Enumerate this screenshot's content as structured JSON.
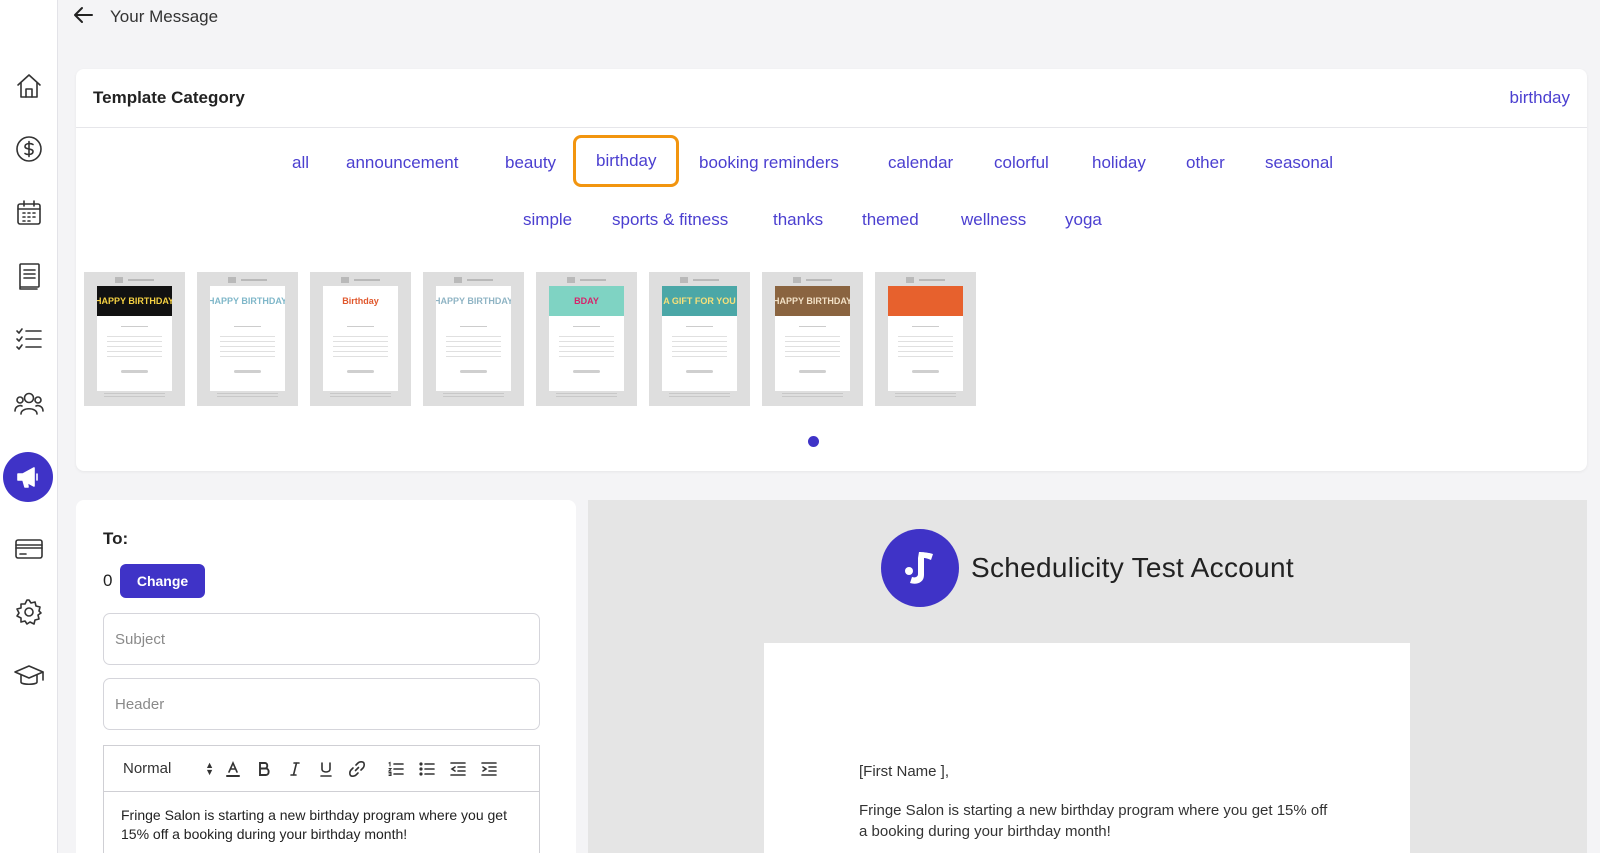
{
  "topbar": {
    "title": "Your Message"
  },
  "sidebar": {
    "items": [
      {
        "icon": "home-icon"
      },
      {
        "icon": "dollar-icon"
      },
      {
        "icon": "calendar-icon"
      },
      {
        "icon": "book-icon"
      },
      {
        "icon": "checklist-icon"
      },
      {
        "icon": "people-icon"
      },
      {
        "icon": "megaphone-icon",
        "active": true
      },
      {
        "icon": "card-icon"
      },
      {
        "icon": "gear-icon"
      },
      {
        "icon": "graduation-cap-icon"
      }
    ]
  },
  "template_category": {
    "label": "Template Category",
    "selected": "birthday",
    "categories": [
      "all",
      "announcement",
      "beauty",
      "birthday",
      "booking reminders",
      "calendar",
      "colorful",
      "holiday",
      "other",
      "seasonal",
      "simple",
      "sports & fitness",
      "thanks",
      "themed",
      "wellness",
      "yoga"
    ],
    "templates": [
      {
        "banner_text": "HAPPY BIRTHDAY",
        "banner_bg": "#111111",
        "banner_color": "#f5d142"
      },
      {
        "banner_text": "HAPPY BIRTHDAY",
        "banner_bg": "#ffffff",
        "banner_color": "#7fb7c9"
      },
      {
        "banner_text": "Birthday",
        "banner_bg": "#ffffff",
        "banner_color": "#e0572c"
      },
      {
        "banner_text": "HAPPY BIRTHDAY",
        "banner_bg": "#ffffff",
        "banner_color": "#8fb4c4"
      },
      {
        "banner_text": "BDAY",
        "banner_bg": "#7fd3c3",
        "banner_color": "#d6246b"
      },
      {
        "banner_text": "A GIFT FOR YOU",
        "banner_bg": "#4ba7a7",
        "banner_color": "#f7e07a"
      },
      {
        "banner_text": "HAPPY BIRTHDAY",
        "banner_bg": "#8a6440",
        "banner_color": "#f2e1c6"
      },
      {
        "banner_text": "",
        "banner_bg": "#e7612d",
        "banner_color": "#f3b73c"
      }
    ]
  },
  "compose": {
    "to_label": "To:",
    "recipient_count": "0",
    "change_label": "Change",
    "subject_placeholder": "Subject",
    "header_placeholder": "Header",
    "format_label": "Normal",
    "body_text": "Fringe Salon is starting a new birthday program where you get 15% off a booking during your birthday month!"
  },
  "preview": {
    "account_name": "Schedulicity Test Account",
    "greeting": "[First Name ],",
    "body_text": "Fringe Salon is starting a new birthday program where you get 15% off a booking during your birthday month!"
  },
  "colors": {
    "accent": "#3f33c7",
    "link": "#4b3fd0",
    "highlight": "#f2950f"
  }
}
